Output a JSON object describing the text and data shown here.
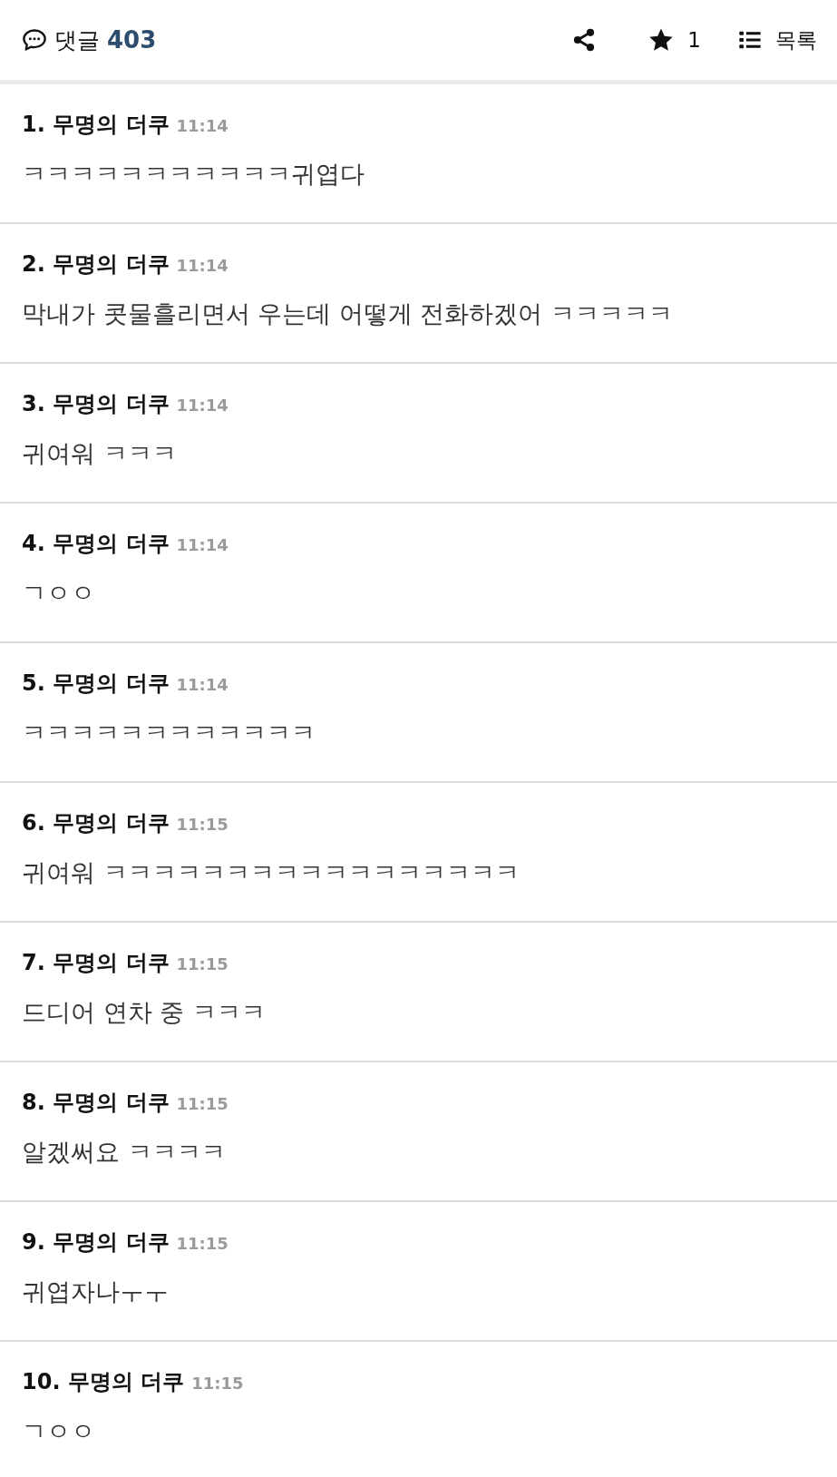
{
  "header": {
    "label": "댓글",
    "count": "403",
    "favorites": "1",
    "list_label": "목록"
  },
  "comments": [
    {
      "number": "1.",
      "author": "무명의 더쿠",
      "time": "11:14",
      "text": "ㅋㅋㅋㅋㅋㅋㅋㅋㅋㅋㅋ귀엽다"
    },
    {
      "number": "2.",
      "author": "무명의 더쿠",
      "time": "11:14",
      "text": "막내가 콧물흘리면서 우는데 어떻게 전화하겠어 ㅋㅋㅋㅋㅋ"
    },
    {
      "number": "3.",
      "author": "무명의 더쿠",
      "time": "11:14",
      "text": "귀여워 ㅋㅋㅋ"
    },
    {
      "number": "4.",
      "author": "무명의 더쿠",
      "time": "11:14",
      "text": "ㄱㅇㅇ"
    },
    {
      "number": "5.",
      "author": "무명의 더쿠",
      "time": "11:14",
      "text": "ㅋㅋㅋㅋㅋㅋㅋㅋㅋㅋㅋㅋ"
    },
    {
      "number": "6.",
      "author": "무명의 더쿠",
      "time": "11:15",
      "text": "귀여워 ㅋㅋㅋㅋㅋㅋㅋㅋㅋㅋㅋㅋㅋㅋㅋㅋㅋ"
    },
    {
      "number": "7.",
      "author": "무명의 더쿠",
      "time": "11:15",
      "text": "드디어 연차 중 ㅋㅋㅋ"
    },
    {
      "number": "8.",
      "author": "무명의 더쿠",
      "time": "11:15",
      "text": "알겠써요 ㅋㅋㅋㅋ"
    },
    {
      "number": "9.",
      "author": "무명의 더쿠",
      "time": "11:15",
      "text": "귀엽자나ㅜㅜ"
    },
    {
      "number": "10.",
      "author": "무명의 더쿠",
      "time": "11:15",
      "text": "ㄱㅇㅇ"
    }
  ]
}
